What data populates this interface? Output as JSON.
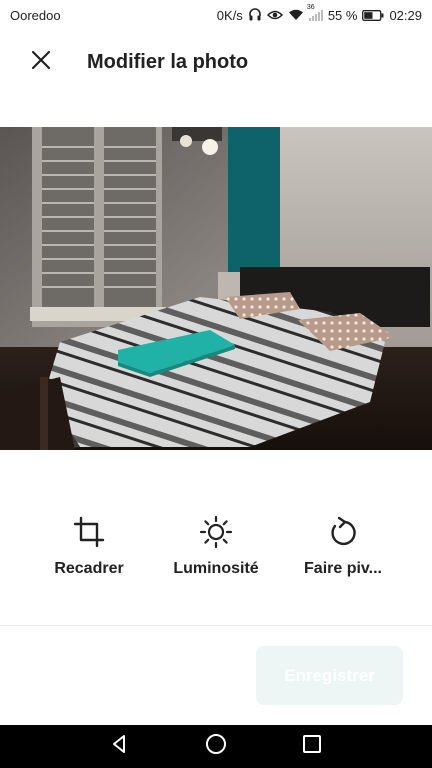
{
  "status_bar": {
    "carrier": "Ooredoo",
    "net_speed": "0K/s",
    "network_type": "36",
    "battery_percent": "55 %",
    "time": "02:29",
    "battery_level": 0.55
  },
  "header": {
    "title": "Modifier la photo",
    "close_icon": "close-icon"
  },
  "photo": {
    "description_icon": "photo-image"
  },
  "tools": [
    {
      "label": "Recadrer",
      "icon": "crop-icon"
    },
    {
      "label": "Luminosité",
      "icon": "brightness-icon"
    },
    {
      "label": "Faire piv...",
      "icon": "rotate-icon"
    }
  ],
  "footer": {
    "save_label": "Enregistrer"
  },
  "colors": {
    "accent": "#00a699",
    "save_disabled_bg": "#edf6f4"
  },
  "navbar": {
    "icons": [
      "back-icon",
      "home-icon",
      "recents-icon"
    ]
  }
}
